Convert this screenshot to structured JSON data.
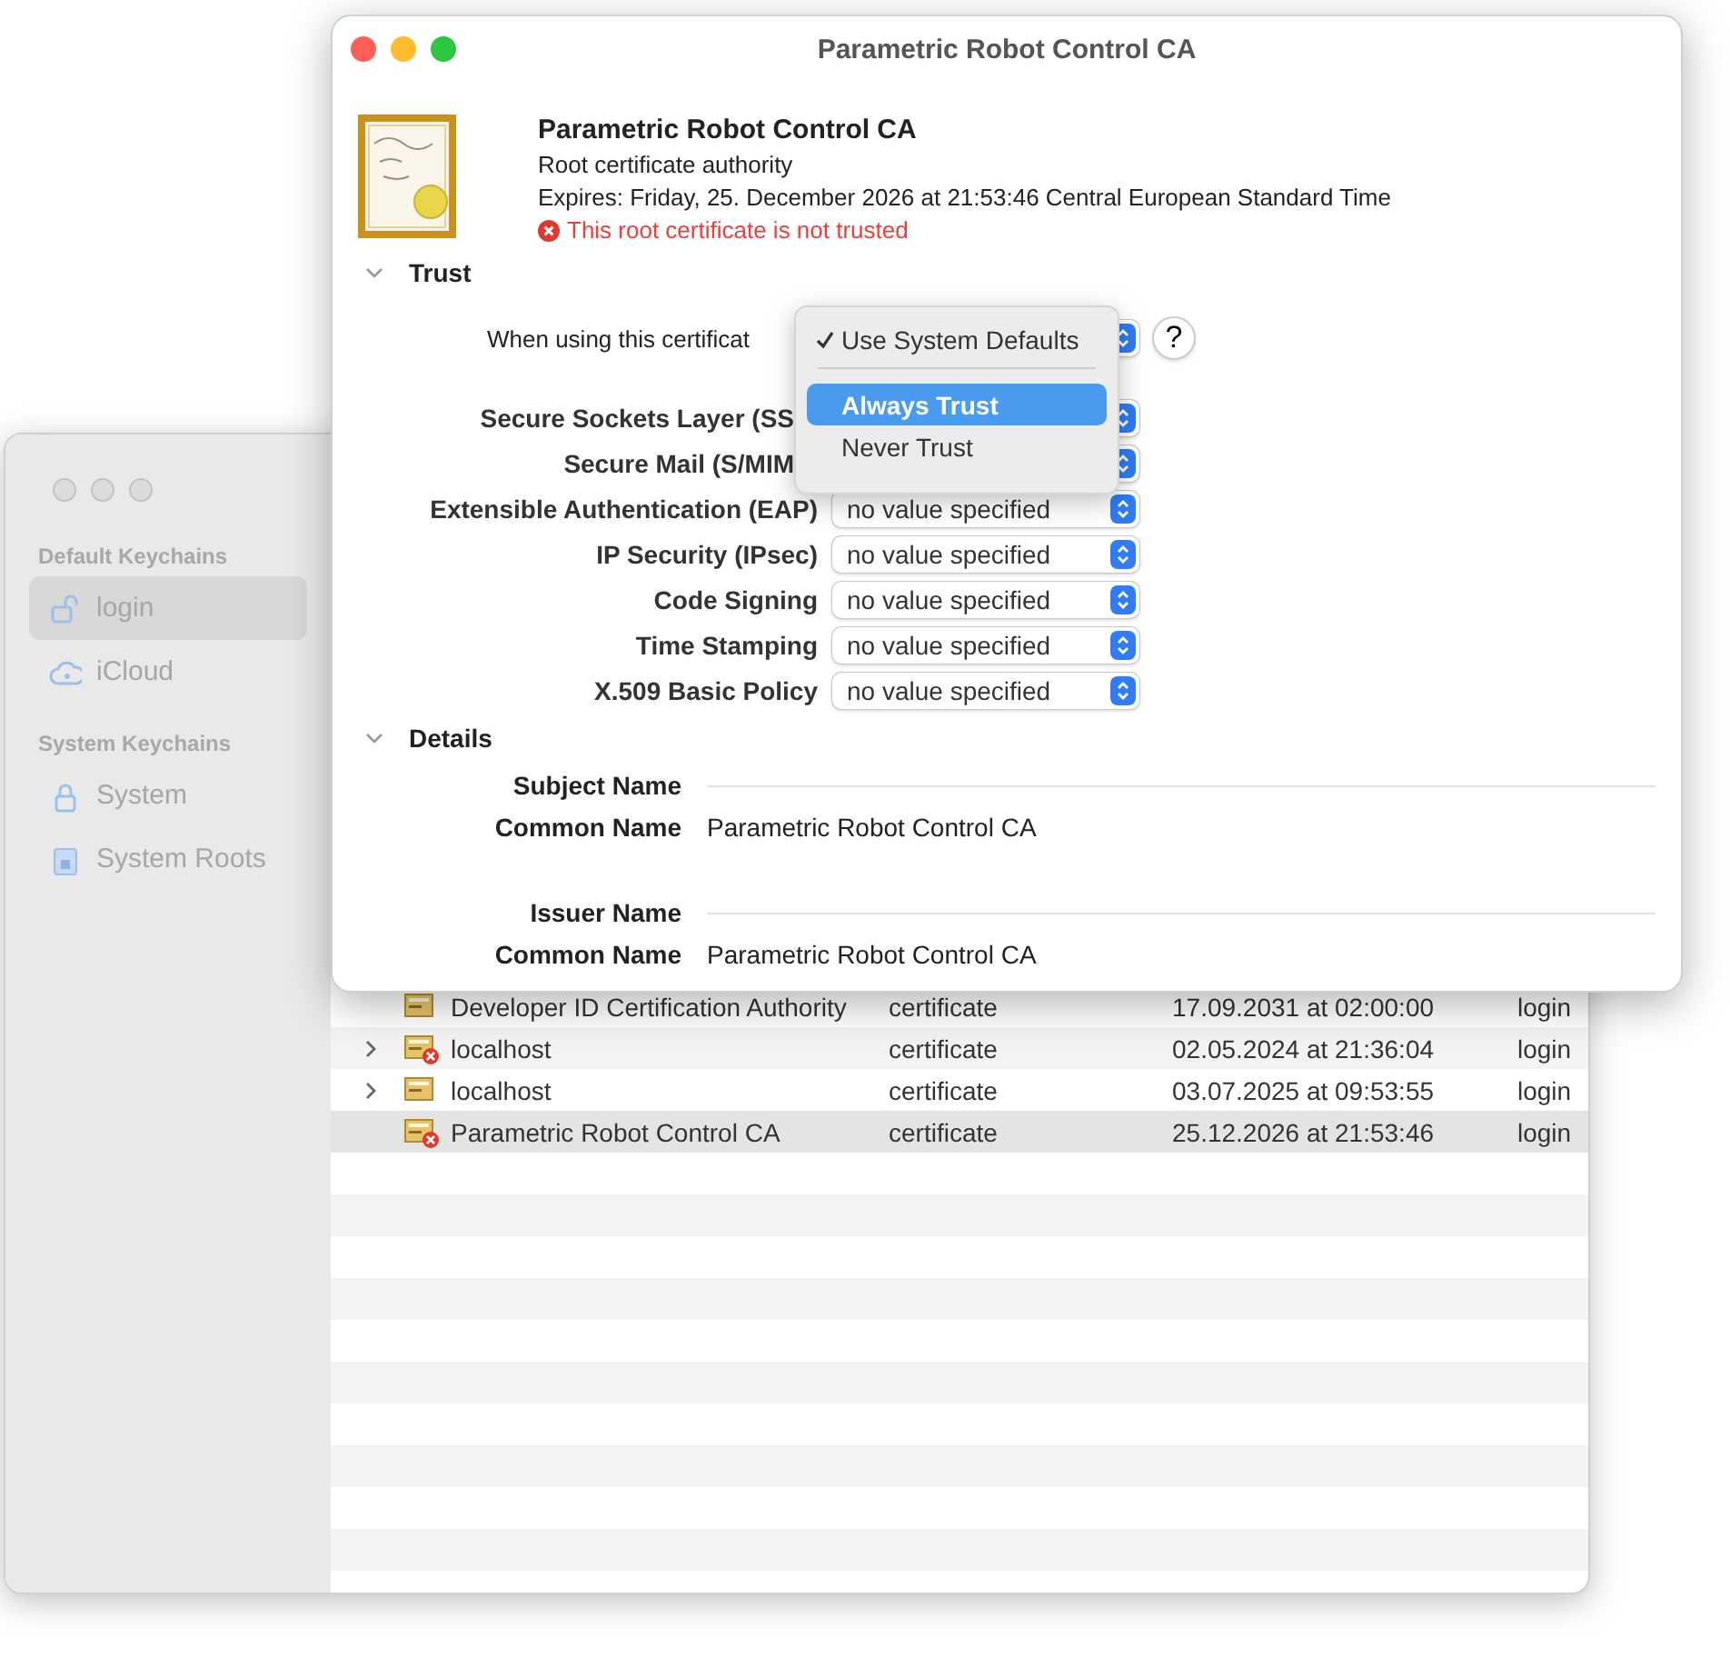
{
  "keychain_window": {
    "sidebar": {
      "sections": [
        {
          "heading": "Default Keychains",
          "items": [
            {
              "label": "login",
              "selected": true
            },
            {
              "label": "iCloud",
              "selected": false
            }
          ]
        },
        {
          "heading": "System Keychains",
          "items": [
            {
              "label": "System",
              "selected": false
            },
            {
              "label": "System Roots",
              "selected": false
            }
          ]
        }
      ]
    },
    "table": {
      "rows": [
        {
          "name": "Developer ID Certification Authority",
          "kind": "certificate",
          "expires": "17.09.2031 at 02:00:00",
          "keychain": "login",
          "expandable": false,
          "untrusted": false,
          "selected": false
        },
        {
          "name": "localhost",
          "kind": "certificate",
          "expires": "02.05.2024 at 21:36:04",
          "keychain": "login",
          "expandable": true,
          "untrusted": true,
          "selected": false
        },
        {
          "name": "localhost",
          "kind": "certificate",
          "expires": "03.07.2025 at 09:53:55",
          "keychain": "login",
          "expandable": true,
          "untrusted": false,
          "selected": false
        },
        {
          "name": "Parametric Robot Control CA",
          "kind": "certificate",
          "expires": "25.12.2026 at 21:53:46",
          "keychain": "login",
          "expandable": false,
          "untrusted": true,
          "selected": true
        }
      ]
    }
  },
  "dialog": {
    "title": "Parametric Robot Control CA",
    "certificate": {
      "name": "Parametric Robot Control CA",
      "type": "Root certificate authority",
      "expires": "Expires: Friday, 25. December 2026 at 21:53:46 Central European Standard Time",
      "warning": "This root certificate is not trusted"
    },
    "trust": {
      "heading": "Trust",
      "expanded": true,
      "when_using_label": "When using this certificat",
      "help": "?",
      "menu": [
        {
          "kind": "item",
          "label": "Use System Defaults",
          "checked": true,
          "selected": false
        },
        {
          "kind": "separator"
        },
        {
          "kind": "item",
          "label": "Always Trust",
          "checked": false,
          "selected": true
        },
        {
          "kind": "item",
          "label": "Never Trust",
          "checked": false,
          "selected": false
        }
      ],
      "policies": [
        {
          "label": "Secure Sockets Layer (SS"
        },
        {
          "label": "Secure Mail (S/MIM"
        },
        {
          "label": "Extensible Authentication (EAP)",
          "value": "no value specified"
        },
        {
          "label": "IP Security (IPsec)",
          "value": "no value specified"
        },
        {
          "label": "Code Signing",
          "value": "no value specified"
        },
        {
          "label": "Time Stamping",
          "value": "no value specified"
        },
        {
          "label": "X.509 Basic Policy",
          "value": "no value specified"
        }
      ]
    },
    "details": {
      "heading": "Details",
      "expanded": true,
      "groups": [
        {
          "heading": "Subject Name",
          "fields": [
            {
              "label": "Common Name",
              "value": "Parametric Robot Control CA"
            }
          ]
        },
        {
          "heading": "Issuer Name",
          "fields": [
            {
              "label": "Common Name",
              "value": "Parametric Robot Control CA"
            }
          ]
        }
      ]
    }
  }
}
